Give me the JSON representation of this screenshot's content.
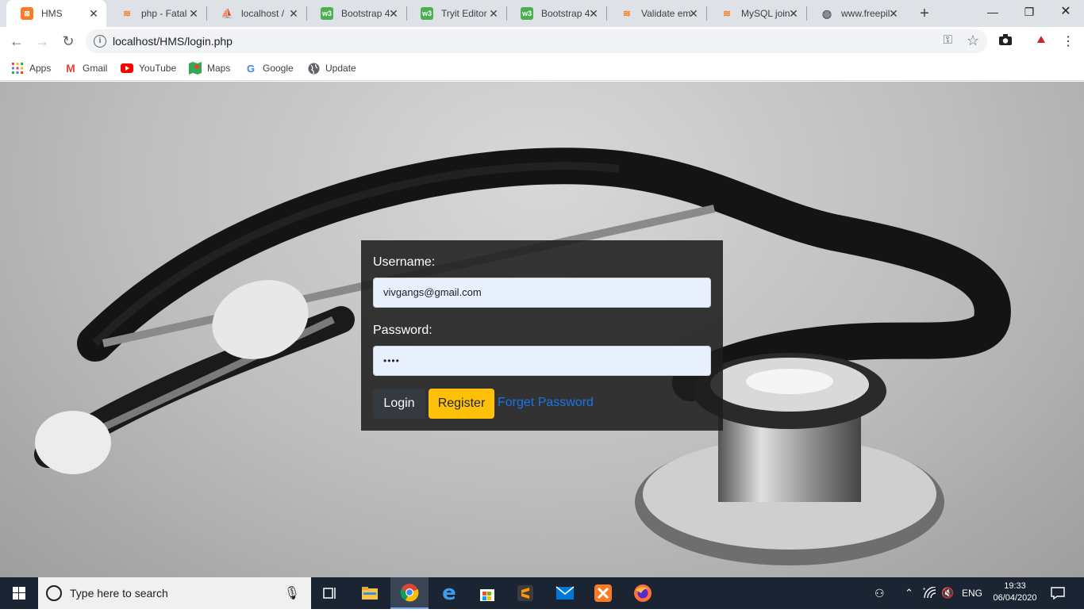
{
  "tabs": [
    {
      "title": "HMS",
      "icon": "xampp-icon",
      "active": true
    },
    {
      "title": "php - Fatal",
      "icon": "stackoverflow-icon"
    },
    {
      "title": "localhost /",
      "icon": "phpmyadmin-icon"
    },
    {
      "title": "Bootstrap 4",
      "icon": "w3schools-icon"
    },
    {
      "title": "Tryit Editor",
      "icon": "w3schools-icon"
    },
    {
      "title": "Bootstrap 4",
      "icon": "w3schools-icon"
    },
    {
      "title": "Validate em",
      "icon": "stackoverflow-icon"
    },
    {
      "title": "MySQL join",
      "icon": "stackoverflow-icon"
    },
    {
      "title": "www.freepil",
      "icon": "globe-icon"
    }
  ],
  "address": {
    "url": "localhost/HMS/login.php"
  },
  "bookmarks": [
    {
      "label": "Apps",
      "icon": "apps-grid-icon"
    },
    {
      "label": "Gmail",
      "icon": "gmail-icon"
    },
    {
      "label": "YouTube",
      "icon": "youtube-icon"
    },
    {
      "label": "Maps",
      "icon": "maps-icon"
    },
    {
      "label": "Google",
      "icon": "google-icon"
    },
    {
      "label": "Update",
      "icon": "globe-icon"
    }
  ],
  "login": {
    "username_label": "Username:",
    "username_value": "vivgangs@gmail.com",
    "password_label": "Password:",
    "password_value": "••••",
    "login_button": "Login",
    "register_button": "Register",
    "forget_link": "Forget Password"
  },
  "colors": {
    "register": "#ffc107",
    "login_btn": "#343a40",
    "link": "#1a73e8",
    "taskbar": "#1b2433"
  },
  "taskbar": {
    "search_placeholder": "Type here to search",
    "language": "ENG",
    "time": "19:33",
    "date": "06/04/2020"
  }
}
